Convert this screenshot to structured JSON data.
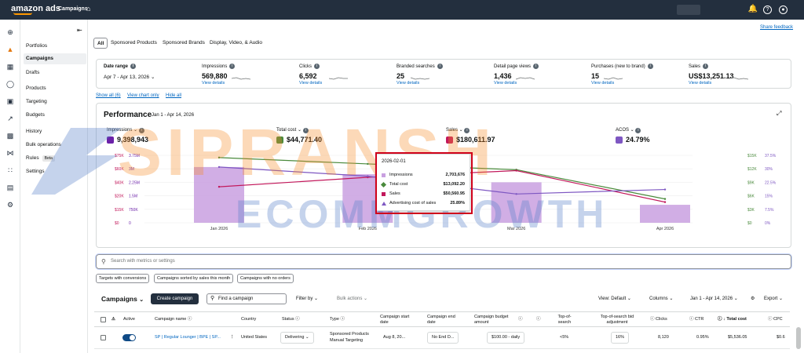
{
  "topbar": {
    "logo": "amazon ads",
    "section": "Campaigns",
    "home_icon": "home-icon",
    "icons": [
      "bell-icon",
      "help-icon",
      "user-icon"
    ]
  },
  "rail_icons": [
    "plus-icon",
    "megaphone-icon",
    "grid-icon",
    "shield-icon",
    "image-icon",
    "chart-line-icon",
    "bar-chart-icon",
    "network-icon",
    "apps-icon",
    "briefcase-icon",
    "settings-icon"
  ],
  "leftnav": {
    "items": [
      "Portfolios",
      "Campaigns",
      "Drafts",
      "Products",
      "Targeting",
      "Budgets",
      "History",
      "Bulk operations",
      "Rules",
      "Settings"
    ],
    "beta": "Beta"
  },
  "share_feedback": "Share feedback",
  "tabs": [
    "All",
    "Sponsored Products",
    "Sponsored Brands",
    "Display, Video, & Audio"
  ],
  "summary": {
    "date_label": "Date range",
    "date_value": "Apr 7 - Apr 13, 2026",
    "metrics": [
      {
        "label": "Impressions",
        "value": "569,880",
        "link": "View details"
      },
      {
        "label": "Clicks",
        "value": "6,592",
        "link": "View details"
      },
      {
        "label": "Branded searches",
        "value": "25",
        "link": "View details"
      },
      {
        "label": "Detail page views",
        "value": "1,436",
        "link": "View details"
      },
      {
        "label": "Purchases (new to brand)",
        "value": "15",
        "link": "View details"
      },
      {
        "label": "Sales",
        "value": "US$13,251.13",
        "link": "View details"
      }
    ]
  },
  "chart_links": {
    "show_all": "Show all (6)",
    "view_chart": "View chart only",
    "hide_all": "Hide all"
  },
  "performance": {
    "title": "Performance",
    "range": "Jan 1 - Apr 14, 2026",
    "metrics": [
      {
        "label": "Impressions",
        "value": "9,398,943",
        "color": "#6b21a8"
      },
      {
        "label": "Total cost",
        "value": "$44,771.40",
        "color": "#4a8a3c"
      },
      {
        "label": "Sales",
        "value": "$180,611.97",
        "color": "#c2185b"
      },
      {
        "label": "ACOS",
        "value": "24.79%",
        "color": "#7e57c2"
      }
    ]
  },
  "chart_data": {
    "type": "bar",
    "categories": [
      "Jan 2026",
      "Feb 2026",
      "Mar 2026",
      "Apr 2026"
    ],
    "y_left_ticks_sales": [
      "$0",
      "$15K",
      "$20K",
      "$40K",
      "$60K",
      "$75K"
    ],
    "y_left_ticks_imp": [
      "0",
      "750K",
      "1.5M",
      "2.25M",
      "3M",
      "3.75M"
    ],
    "y_right_ticks_cost": [
      "$0",
      "$3K",
      "$6K",
      "$9K",
      "$12K",
      "$15K"
    ],
    "y_right_ticks_acos": [
      "0%",
      "7.5%",
      "15%",
      "22.5%",
      "30%",
      "37.5%"
    ],
    "series": [
      {
        "name": "Impressions",
        "kind": "bar",
        "values": [
          3100000,
          2700000,
          2250000,
          1000000
        ]
      },
      {
        "name": "Total cost",
        "kind": "line",
        "values": [
          14500,
          13092.2,
          11800,
          5300
        ]
      },
      {
        "name": "Sales",
        "kind": "line",
        "values": [
          40000,
          50560.95,
          58000,
          23000
        ]
      },
      {
        "name": "Advertising cost of sales",
        "kind": "line",
        "values": [
          31,
          25.89,
          16,
          18.5
        ]
      }
    ]
  },
  "tooltip": {
    "date": "2026-02-01",
    "rows": [
      {
        "label": "Impressions",
        "value": "2,703,676",
        "color": "#c9a0e0"
      },
      {
        "label": "Total cost",
        "value": "$13,092.20",
        "color": "#4a8a3c"
      },
      {
        "label": "Sales",
        "value": "$50,560.95",
        "color": "#c2185b"
      },
      {
        "label": "Advertising cost of sales",
        "value": "25.89%",
        "color": "#7e57c2"
      }
    ]
  },
  "watermark": {
    "line1": "SIPRANSH",
    "line2": "ECOMMGROWTH"
  },
  "search_placeholder": "Search with metrics or settings",
  "chips": [
    "Targets with conversions",
    "Campaigns sorted by sales this month",
    "Campaigns with no orders"
  ],
  "campaigns_toolbar": {
    "title": "Campaigns",
    "create": "Create campaign",
    "find_placeholder": "Find a campaign",
    "filter": "Filter by",
    "bulk": "Bulk actions",
    "view": "View: Default",
    "columns": "Columns",
    "range": "Jan 1 - Apr 14, 2026",
    "export": "Export"
  },
  "table": {
    "headers": [
      "Active",
      "Campaign name",
      "Country",
      "Status",
      "Type",
      "Campaign start date",
      "Campaign end date",
      "Campaign budget amount",
      "Top-of-search",
      "Top-of-search bid adjustment",
      "Clicks",
      "CTR",
      "Total cost",
      "CPC"
    ],
    "row": {
      "name": "SP | Regular Lounger | BPE | SP...",
      "country": "United States",
      "status": "Delivering",
      "type_line1": "Sponsored Products",
      "type_line2": "Manual Targeting",
      "start": "Aug 8, 20...",
      "end": "No End D...",
      "budget": "$100.00 - daily",
      "tos": "<5%",
      "tos_bid": "16%",
      "clicks": "8,120",
      "ctr": "0.95%",
      "total_cost": "$5,536.05",
      "cpc": "$0.6"
    }
  }
}
